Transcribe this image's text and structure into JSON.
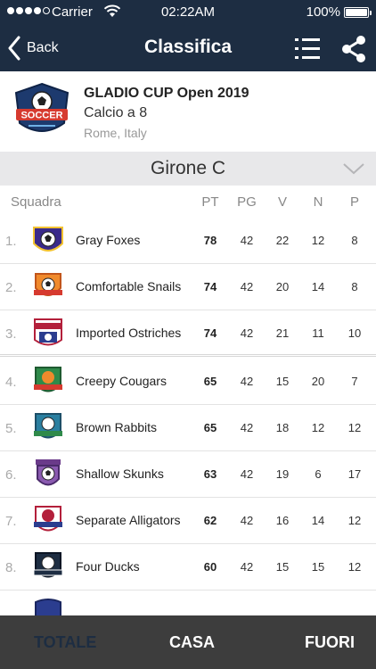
{
  "status": {
    "carrier": "Carrier",
    "time": "02:22AM",
    "battery": "100%"
  },
  "nav": {
    "back_label": "Back",
    "title": "Classifica"
  },
  "tournament": {
    "name": "GLADIO CUP Open 2019",
    "type": "Calcio a 8",
    "place": "Rome, Italy",
    "logo_text": "SOCCER"
  },
  "group": {
    "title": "Girone C"
  },
  "table": {
    "headers": {
      "team": "Squadra",
      "pt": "PT",
      "pg": "PG",
      "v": "V",
      "n": "N",
      "p": "P"
    },
    "rows": [
      {
        "rank": "1.",
        "team": "Gray Foxes",
        "pt": "78",
        "pg": "42",
        "v": "22",
        "n": "12",
        "p": "8"
      },
      {
        "rank": "2.",
        "team": "Comfortable Snails",
        "pt": "74",
        "pg": "42",
        "v": "20",
        "n": "14",
        "p": "8"
      },
      {
        "rank": "3.",
        "team": "Imported Ostriches",
        "pt": "74",
        "pg": "42",
        "v": "21",
        "n": "11",
        "p": "10"
      },
      {
        "rank": "4.",
        "team": "Creepy Cougars",
        "pt": "65",
        "pg": "42",
        "v": "15",
        "n": "20",
        "p": "7"
      },
      {
        "rank": "5.",
        "team": "Brown Rabbits",
        "pt": "65",
        "pg": "42",
        "v": "18",
        "n": "12",
        "p": "12"
      },
      {
        "rank": "6.",
        "team": "Shallow Skunks",
        "pt": "63",
        "pg": "42",
        "v": "19",
        "n": "6",
        "p": "17"
      },
      {
        "rank": "7.",
        "team": "Separate Alligators",
        "pt": "62",
        "pg": "42",
        "v": "16",
        "n": "14",
        "p": "12"
      },
      {
        "rank": "8.",
        "team": "Four Ducks",
        "pt": "60",
        "pg": "42",
        "v": "15",
        "n": "15",
        "p": "12"
      }
    ]
  },
  "tabs": {
    "totale": "TOTALE",
    "casa": "CASA",
    "fuori": "FUORI"
  },
  "colors": {
    "navbar": "#1d2d42",
    "group_bar": "#e8e8ea",
    "tabbar": "#3d3d3d"
  }
}
